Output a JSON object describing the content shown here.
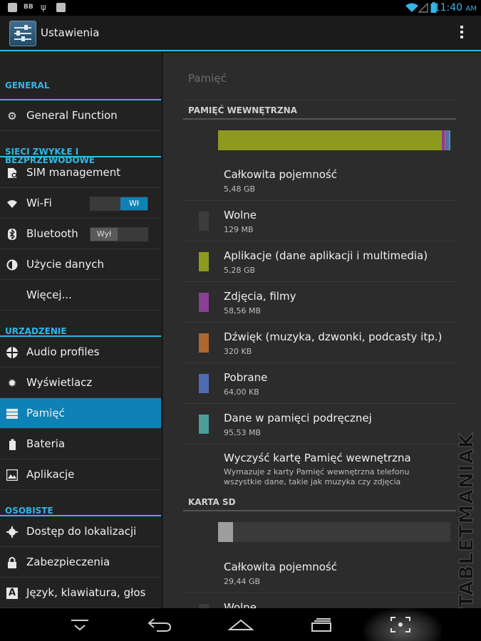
{
  "status_bar": {
    "time": "11:40",
    "ampm": "AM",
    "icons": [
      "image-icon",
      "bbm-icon",
      "usb-icon",
      "briefcase-icon",
      "wifi-icon",
      "signal-icon",
      "battery-icon"
    ]
  },
  "action_bar": {
    "title": "Ustawienia",
    "app_icon": "settings-sliders-icon",
    "overflow_icon": "overflow-menu-icon"
  },
  "sidebar": {
    "sections": [
      {
        "header": "GENERAL",
        "items": [
          {
            "label": "General Function",
            "icon": "gear-icon"
          }
        ]
      },
      {
        "header": "SIECI ZWYKŁE I BEZPRZEWODOWE",
        "items": [
          {
            "label": "SIM management",
            "icon": "sim-card-icon"
          },
          {
            "label": "Wi-Fi",
            "icon": "wifi-icon",
            "toggle": "Wł",
            "toggle_on": true
          },
          {
            "label": "Bluetooth",
            "icon": "bluetooth-icon",
            "toggle": "Wył",
            "toggle_on": false
          },
          {
            "label": "Użycie danych",
            "icon": "data-usage-icon"
          },
          {
            "label": "Więcej...",
            "icon": ""
          }
        ]
      },
      {
        "header": "URZĄDZENIE",
        "items": [
          {
            "label": "Audio profiles",
            "icon": "audio-profiles-icon"
          },
          {
            "label": "Wyświetlacz",
            "icon": "brightness-icon"
          },
          {
            "label": "Pamięć",
            "icon": "storage-icon",
            "active": true
          },
          {
            "label": "Bateria",
            "icon": "battery-icon"
          },
          {
            "label": "Aplikacje",
            "icon": "apps-icon"
          }
        ]
      },
      {
        "header": "OSOBISTE",
        "items": [
          {
            "label": "Dostęp do lokalizacji",
            "icon": "location-icon"
          },
          {
            "label": "Zabezpieczenia",
            "icon": "lock-icon"
          },
          {
            "label": "Język, klawiatura, głos",
            "icon": "language-icon"
          }
        ]
      }
    ]
  },
  "main": {
    "title": "Pamięć",
    "internal": {
      "header": "PAMIĘĆ WEWNĘTRZNA",
      "usage_fractions": [
        {
          "name": "Aplikacje",
          "fraction": 0.963,
          "color": "#8e9a1f"
        },
        {
          "name": "Zdjęcia, filmy",
          "fraction": 0.012,
          "color": "#8a3e96"
        },
        {
          "name": "Dźwięk",
          "fraction": 0.006,
          "color": "#b0662f"
        },
        {
          "name": "Pobrane",
          "fraction": 0.012,
          "color": "#4f6cb3"
        },
        {
          "name": "Dane w pamięci podręcznej",
          "fraction": 0.017,
          "color": "#4b9e97"
        }
      ],
      "total": {
        "label": "Całkowita pojemność",
        "value": "5,48 GB"
      },
      "rows": [
        {
          "label": "Wolne",
          "value": "129 MB",
          "color": "#3c3c3c"
        },
        {
          "label": "Aplikacje (dane aplikacji i multimedia)",
          "value": "5,28 GB",
          "color": "#8e9a1f"
        },
        {
          "label": "Zdjęcia, filmy",
          "value": "58,56 MB",
          "color": "#8a3e96"
        },
        {
          "label": "Dźwięk (muzyka, dzwonki, podcasty itp.)",
          "value": "320 KB",
          "color": "#b0662f"
        },
        {
          "label": "Pobrane",
          "value": "64,00 KB",
          "color": "#4f6cb3"
        },
        {
          "label": "Dane w pamięci podręcznej",
          "value": "95,53 MB",
          "color": "#4b9e97"
        }
      ],
      "clear": {
        "label": "Wyczyść kartę Pamięć wewnętrzna",
        "desc": "Wymazuje z karty Pamięć wewnętrzna telefonu wszystkie dane, takie jak muzyka czy zdjęcia"
      }
    },
    "sd": {
      "header": "KARTA SD",
      "used_fraction": 0.064,
      "used_color": "#9e9e9e",
      "total": {
        "label": "Całkowita pojemność",
        "value": "29,44 GB"
      },
      "next_label": "Wolne"
    }
  },
  "watermark": "TABLETMANIAK",
  "nav_bar": {
    "icons": [
      "hide-keyboard-icon",
      "back-icon",
      "home-icon",
      "recent-apps-icon",
      "screenshot-icon"
    ]
  }
}
